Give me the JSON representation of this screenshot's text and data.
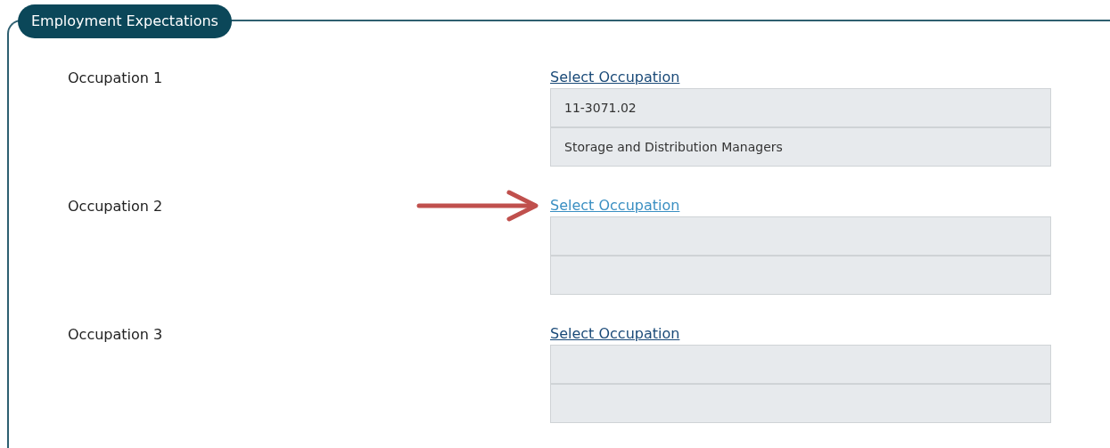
{
  "section": {
    "title": "Employment Expectations"
  },
  "occupations": [
    {
      "label": "Occupation 1",
      "link": "Select Occupation",
      "hovered": false,
      "arrow_pointer": false,
      "code": "11-3071.02",
      "title": "Storage and Distribution Managers"
    },
    {
      "label": "Occupation 2",
      "link": "Select Occupation",
      "hovered": true,
      "arrow_pointer": true
    },
    {
      "label": "Occupation 3",
      "link": "Select Occupation",
      "hovered": false,
      "arrow_pointer": false
    }
  ]
}
